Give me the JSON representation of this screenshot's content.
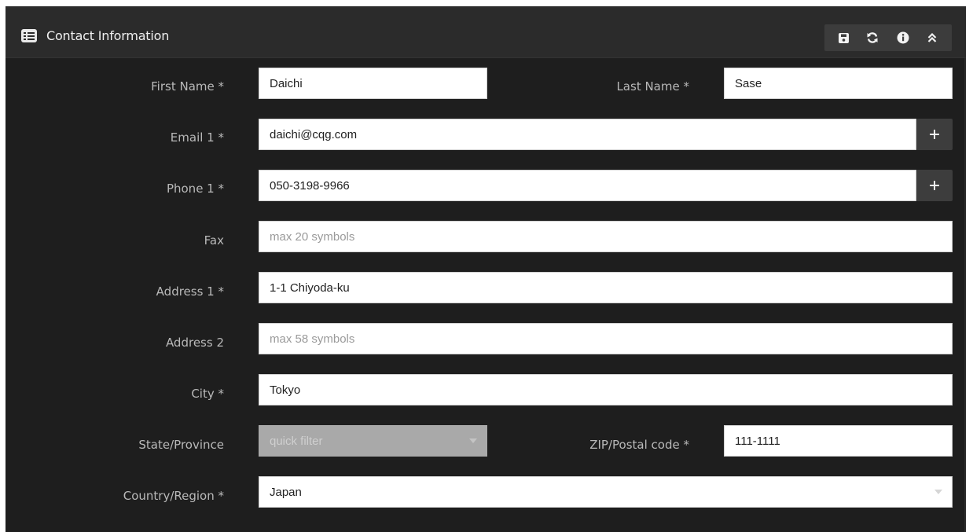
{
  "panel": {
    "title": "Contact Information",
    "tools": [
      "save-icon",
      "refresh-icon",
      "info-icon",
      "collapse-icon"
    ]
  },
  "form": {
    "first_name": {
      "label": "First Name  *",
      "value": "Daichi"
    },
    "last_name": {
      "label": "Last Name  *",
      "value": "Sase"
    },
    "email1": {
      "label": "Email 1  *",
      "value": "daichi@cqg.com",
      "add_label": "+"
    },
    "phone1": {
      "label": "Phone 1  *",
      "value": "050-3198-9966",
      "add_label": "+"
    },
    "fax": {
      "label": "Fax",
      "placeholder": "max 20 symbols"
    },
    "address1": {
      "label": "Address 1  *",
      "value": "1-1 Chiyoda-ku"
    },
    "address2": {
      "label": "Address 2",
      "placeholder": "max 58 symbols"
    },
    "city": {
      "label": "City  *",
      "value": "Tokyo"
    },
    "state": {
      "label": "State/Province",
      "placeholder": "quick filter"
    },
    "zip": {
      "label": "ZIP/Postal code  *",
      "value": "111-1111"
    },
    "country": {
      "label": "Country/Region  *",
      "value": "Japan"
    }
  }
}
